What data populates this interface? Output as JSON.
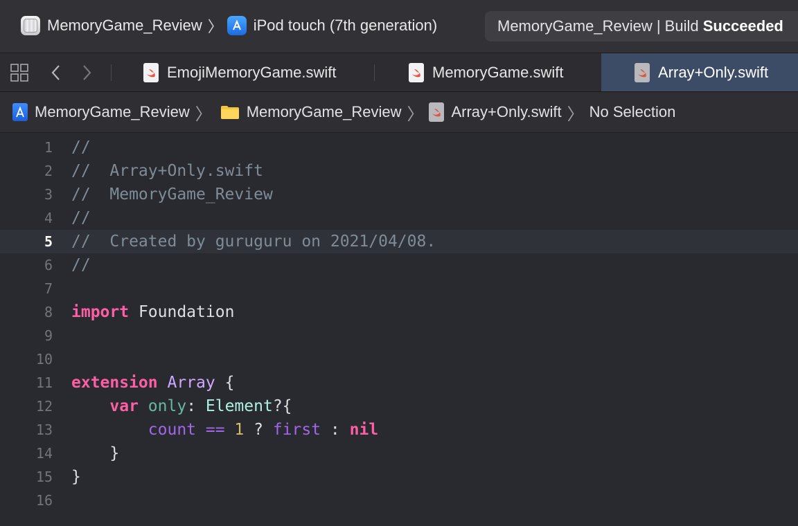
{
  "toolbar": {
    "scheme_name": "MemoryGame_Review",
    "scheme_separator": "〉",
    "destination": "iPod touch (7th generation)",
    "status_prefix": "MemoryGame_Review | Build ",
    "status_strong": "Succeeded"
  },
  "tabbar": {
    "tabs": [
      {
        "label": "EmojiMemoryGame.swift",
        "icon": "swift-file-icon",
        "active": false
      },
      {
        "label": "MemoryGame.swift",
        "icon": "swift-file-icon",
        "active": false
      },
      {
        "label": "Array+Only.swift",
        "icon": "swift-file-icon",
        "active": true
      }
    ]
  },
  "jumpbar": {
    "project": "MemoryGame_Review",
    "group": "MemoryGame_Review",
    "file": "Array+Only.swift",
    "selection": "No Selection",
    "separator": "〉"
  },
  "editor": {
    "current_line": 5,
    "lines": [
      {
        "n": "1"
      },
      {
        "n": "2"
      },
      {
        "n": "3"
      },
      {
        "n": "4"
      },
      {
        "n": "5"
      },
      {
        "n": "6"
      },
      {
        "n": "7"
      },
      {
        "n": "8"
      },
      {
        "n": "9"
      },
      {
        "n": "10"
      },
      {
        "n": "11"
      },
      {
        "n": "12"
      },
      {
        "n": "13"
      },
      {
        "n": "14"
      },
      {
        "n": "15"
      },
      {
        "n": "16"
      }
    ],
    "code": {
      "l1": "//",
      "l2": "//  Array+Only.swift",
      "l3": "//  MemoryGame_Review",
      "l4": "//",
      "l5": "//  Created by guruguru on 2021/04/08.",
      "l6": "//",
      "l8_kw": "import",
      "l8_rest": " Foundation",
      "l11_kw": "extension",
      "l11_type": " Array",
      "l11_rest": " {",
      "l12_indent": "    ",
      "l12_kw": "var",
      "l12_name": " only",
      "l12_colon": ": ",
      "l12_type": "Element",
      "l12_rest": "?{",
      "l13_indent": "        ",
      "l13_count": "count",
      "l13_op": " == ",
      "l13_num": "1",
      "l13_q": " ? ",
      "l13_first": "first",
      "l13_colon": " : ",
      "l13_nil": "nil",
      "l14": "    }",
      "l15": "}"
    }
  },
  "colors": {
    "background": "#292a30",
    "keyword": "#fc5fa3",
    "comment": "#7f8c98",
    "active_tab": "#3d4c66"
  }
}
